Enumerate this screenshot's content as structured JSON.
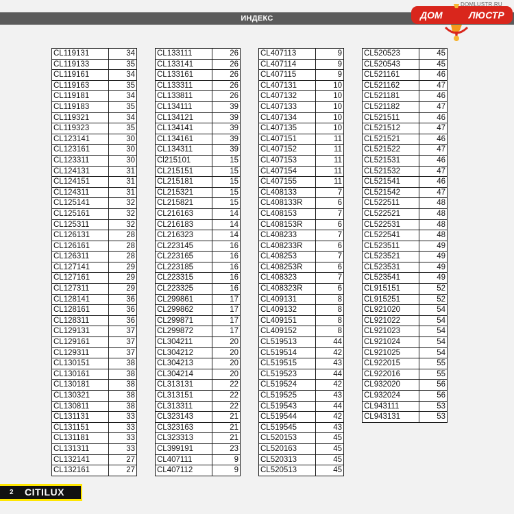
{
  "header": {
    "title": "ИНДЕКС"
  },
  "logo": {
    "url": "DOMLUSTR.RU",
    "left_word": "ДОМ",
    "right_word": "ЛЮСТР"
  },
  "footer": {
    "page_number": "2",
    "brand": "CITILUX"
  },
  "colors": {
    "header_bar": "#5b5b5b",
    "footer_accent": "#ffe600",
    "logo_red": "#d9261c"
  },
  "columns": [
    [
      [
        "CL119131",
        "34"
      ],
      [
        "CL119133",
        "35"
      ],
      [
        "CL119161",
        "34"
      ],
      [
        "CL119163",
        "35"
      ],
      [
        "CL119181",
        "34"
      ],
      [
        "CL119183",
        "35"
      ],
      [
        "CL119321",
        "34"
      ],
      [
        "CL119323",
        "35"
      ],
      [
        "CL123141",
        "30"
      ],
      [
        "CL123161",
        "30"
      ],
      [
        "CL123311",
        "30"
      ],
      [
        "CL124131",
        "31"
      ],
      [
        "CL124151",
        "31"
      ],
      [
        "CL124311",
        "31"
      ],
      [
        "CL125141",
        "32"
      ],
      [
        "CL125161",
        "32"
      ],
      [
        "CL125311",
        "32"
      ],
      [
        "CL126131",
        "28"
      ],
      [
        "CL126161",
        "28"
      ],
      [
        "CL126311",
        "28"
      ],
      [
        "CL127141",
        "29"
      ],
      [
        "CL127161",
        "29"
      ],
      [
        "CL127311",
        "29"
      ],
      [
        "CL128141",
        "36"
      ],
      [
        "CL128161",
        "36"
      ],
      [
        "CL128311",
        "36"
      ],
      [
        "CL129131",
        "37"
      ],
      [
        "CL129161",
        "37"
      ],
      [
        "CL129311",
        "37"
      ],
      [
        "CL130151",
        "38"
      ],
      [
        "CL130161",
        "38"
      ],
      [
        "CL130181",
        "38"
      ],
      [
        "CL130321",
        "38"
      ],
      [
        "CL130811",
        "38"
      ],
      [
        "CL131131",
        "33"
      ],
      [
        "CL131151",
        "33"
      ],
      [
        "CL131181",
        "33"
      ],
      [
        "CL131311",
        "33"
      ],
      [
        "CL132141",
        "27"
      ],
      [
        "CL132161",
        "27"
      ]
    ],
    [
      [
        "CL133111",
        "26"
      ],
      [
        "CL133141",
        "26"
      ],
      [
        "CL133161",
        "26"
      ],
      [
        "CL133311",
        "26"
      ],
      [
        "CL133811",
        "26"
      ],
      [
        "CL134111",
        "39"
      ],
      [
        "CL134121",
        "39"
      ],
      [
        "CL134141",
        "39"
      ],
      [
        "CL134161",
        "39"
      ],
      [
        "CL134311",
        "39"
      ],
      [
        "Cl215101",
        "15"
      ],
      [
        "CL215151",
        "15"
      ],
      [
        "CL215181",
        "15"
      ],
      [
        "CL215321",
        "15"
      ],
      [
        "CL215821",
        "15"
      ],
      [
        "CL216163",
        "14"
      ],
      [
        "CL216183",
        "14"
      ],
      [
        "CL216323",
        "14"
      ],
      [
        "CL223145",
        "16"
      ],
      [
        "CL223165",
        "16"
      ],
      [
        "CL223185",
        "16"
      ],
      [
        "CL223315",
        "16"
      ],
      [
        "CL223325",
        "16"
      ],
      [
        "CL299861",
        "17"
      ],
      [
        "CL299862",
        "17"
      ],
      [
        "CL299871",
        "17"
      ],
      [
        "CL299872",
        "17"
      ],
      [
        "CL304211",
        "20"
      ],
      [
        "CL304212",
        "20"
      ],
      [
        "CL304213",
        "20"
      ],
      [
        "CL304214",
        "20"
      ],
      [
        "CL313131",
        "22"
      ],
      [
        "CL313151",
        "22"
      ],
      [
        "CL313311",
        "22"
      ],
      [
        "CL323143",
        "21"
      ],
      [
        "CL323163",
        "21"
      ],
      [
        "CL323313",
        "21"
      ],
      [
        "CL399191",
        "23"
      ],
      [
        "CL407111",
        "9"
      ],
      [
        "CL407112",
        "9"
      ]
    ],
    [
      [
        "CL407113",
        "9"
      ],
      [
        "CL407114",
        "9"
      ],
      [
        "CL407115",
        "9"
      ],
      [
        "CL407131",
        "10"
      ],
      [
        "CL407132",
        "10"
      ],
      [
        "CL407133",
        "10"
      ],
      [
        "CL407134",
        "10"
      ],
      [
        "CL407135",
        "10"
      ],
      [
        "CL407151",
        "11"
      ],
      [
        "CL407152",
        "11"
      ],
      [
        "CL407153",
        "11"
      ],
      [
        "CL407154",
        "11"
      ],
      [
        "CL407155",
        "11"
      ],
      [
        "CL408133",
        "7"
      ],
      [
        "CL408133R",
        "6"
      ],
      [
        "CL408153",
        "7"
      ],
      [
        "CL408153R",
        "6"
      ],
      [
        "CL408233",
        "7"
      ],
      [
        "CL408233R",
        "6"
      ],
      [
        "CL408253",
        "7"
      ],
      [
        "CL408253R",
        "6"
      ],
      [
        "CL408323",
        "7"
      ],
      [
        "CL408323R",
        "6"
      ],
      [
        "CL409131",
        "8"
      ],
      [
        "CL409132",
        "8"
      ],
      [
        "CL409151",
        "8"
      ],
      [
        "CL409152",
        "8"
      ],
      [
        "CL519513",
        "44"
      ],
      [
        "CL519514",
        "42"
      ],
      [
        "CL519515",
        "43"
      ],
      [
        "CL519523",
        "44"
      ],
      [
        "CL519524",
        "42"
      ],
      [
        "CL519525",
        "43"
      ],
      [
        "CL519543",
        "44"
      ],
      [
        "CL519544",
        "42"
      ],
      [
        "CL519545",
        "43"
      ],
      [
        "CL520153",
        "45"
      ],
      [
        "CL520163",
        "45"
      ],
      [
        "CL520313",
        "45"
      ],
      [
        "CL520513",
        "45"
      ]
    ],
    [
      [
        "CL520523",
        "45"
      ],
      [
        "CL520543",
        "45"
      ],
      [
        "CL521161",
        "46"
      ],
      [
        "CL521162",
        "47"
      ],
      [
        "CL521181",
        "46"
      ],
      [
        "CL521182",
        "47"
      ],
      [
        "CL521511",
        "46"
      ],
      [
        "CL521512",
        "47"
      ],
      [
        "CL521521",
        "46"
      ],
      [
        "CL521522",
        "47"
      ],
      [
        "CL521531",
        "46"
      ],
      [
        "CL521532",
        "47"
      ],
      [
        "CL521541",
        "46"
      ],
      [
        "CL521542",
        "47"
      ],
      [
        "CL522511",
        "48"
      ],
      [
        "CL522521",
        "48"
      ],
      [
        "CL522531",
        "48"
      ],
      [
        "CL522541",
        "48"
      ],
      [
        "CL523511",
        "49"
      ],
      [
        "CL523521",
        "49"
      ],
      [
        "CL523531",
        "49"
      ],
      [
        "CL523541",
        "49"
      ],
      [
        "CL915151",
        "52"
      ],
      [
        "CL915251",
        "52"
      ],
      [
        "CL921020",
        "54"
      ],
      [
        "CL921022",
        "54"
      ],
      [
        "CL921023",
        "54"
      ],
      [
        "CL921024",
        "54"
      ],
      [
        "CL921025",
        "54"
      ],
      [
        "CL922015",
        "55"
      ],
      [
        "CL922016",
        "55"
      ],
      [
        "CL932020",
        "56"
      ],
      [
        "CL932024",
        "56"
      ],
      [
        "CL943111",
        "53"
      ],
      [
        "CL943131",
        "53"
      ]
    ]
  ]
}
